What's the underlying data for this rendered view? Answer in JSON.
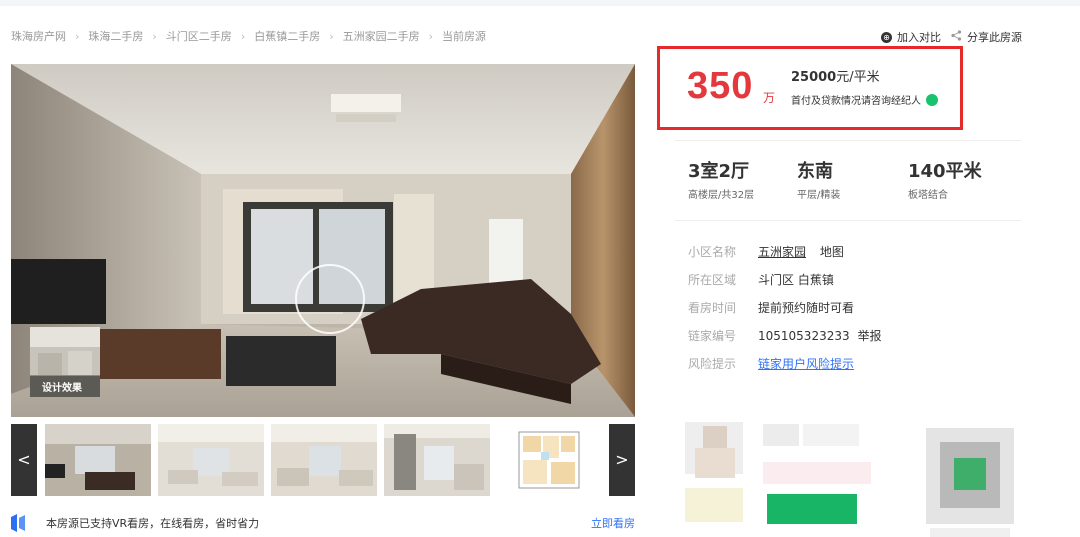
{
  "breadcrumb": [
    "珠海房产网",
    "珠海二手房",
    "斗门区二手房",
    "白蕉镇二手房",
    "五洲家园二手房",
    "当前房源"
  ],
  "actions": {
    "compare": "加入对比",
    "share": "分享此房源"
  },
  "gallery": {
    "design_label": "设计效果",
    "prev": "<",
    "next": ">"
  },
  "vr": {
    "text": "本房源已支持VR看房，在线看房，省时省力",
    "link": "立即看房"
  },
  "price": {
    "total": "350",
    "total_unit": "万",
    "unit_price_num": "25000",
    "unit_price_unit": "元/平米",
    "note": "首付及贷款情况请咨询经纪人"
  },
  "room": [
    {
      "main": "3室2厅",
      "sub": "高楼层/共32层"
    },
    {
      "main": "东南",
      "sub": "平层/精装"
    },
    {
      "main": "140平米",
      "sub": "板塔结合"
    }
  ],
  "details": {
    "community": {
      "label": "小区名称",
      "value": "五洲家园",
      "extra": "地图"
    },
    "area": {
      "label": "所在区域",
      "value": "斗门区 白蕉镇"
    },
    "visit": {
      "label": "看房时间",
      "value": "提前预约随时可看"
    },
    "code": {
      "label": "链家编号",
      "value": "105105323233",
      "extra": "举报"
    },
    "risk": {
      "label": "风险提示",
      "value": "链家用户风险提示"
    }
  },
  "colors": {
    "accent": "#e4393c",
    "link": "#3072f6",
    "chat": "#19c26c",
    "border": "#e62929"
  }
}
